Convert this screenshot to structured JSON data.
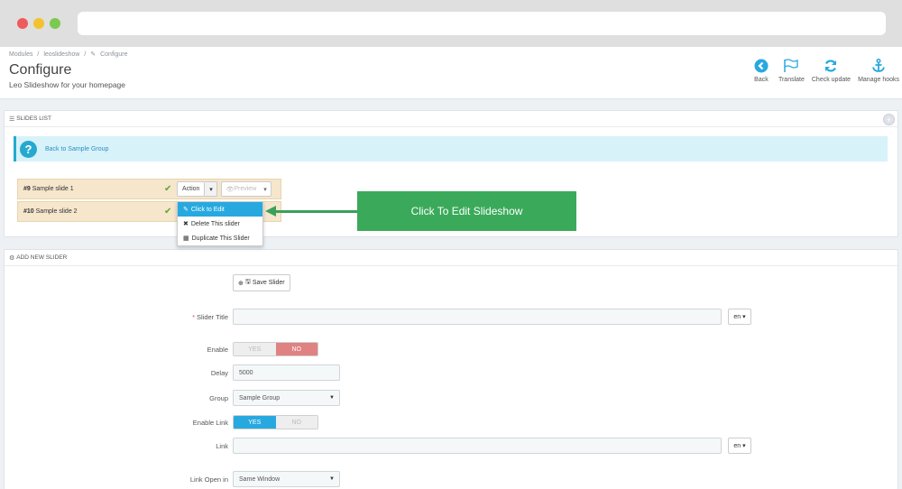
{
  "breadcrumb": [
    "Modules",
    "/",
    "leoslideshow",
    "/",
    "Configure"
  ],
  "header": {
    "title": "Configure",
    "subtitle": "Leo Slideshow for your homepage"
  },
  "toolbar": {
    "back": "Back",
    "translate": "Translate",
    "check_update": "Check update",
    "manage_hooks": "Manage hooks"
  },
  "colors": {
    "accent": "#27a9e0",
    "callout": "#3aaa5a",
    "slide_row": "#f5e6cc",
    "no_active": "#e08282"
  },
  "slides_panel": {
    "title": "SLIDES LIST",
    "back_link": "Back to Sample Group",
    "slides": [
      {
        "id": "#9",
        "name": "Sample slide 1"
      },
      {
        "id": "#10",
        "name": "Sample slide 2"
      }
    ],
    "action_label": "Action",
    "preview_label": "Preview",
    "dropdown": [
      "Click to Edit",
      "Delete This slider",
      "Duplicate This Slider"
    ],
    "callout": "Click To Edit Slideshow"
  },
  "add_panel": {
    "title": "ADD NEW SLIDER",
    "save_label": "Save Slider",
    "fields": {
      "slider_title": {
        "label": "Slider Title",
        "value": "",
        "lang": "en"
      },
      "enable": {
        "label": "Enable",
        "yes": "YES",
        "no": "NO",
        "value": "NO"
      },
      "delay": {
        "label": "Delay",
        "value": "5000"
      },
      "group": {
        "label": "Group",
        "value": "Sample Group"
      },
      "enable_link": {
        "label": "Enable Link",
        "yes": "YES",
        "no": "NO",
        "value": "YES"
      },
      "link": {
        "label": "Link",
        "value": "",
        "lang": "en"
      },
      "link_open": {
        "label": "Link Open in",
        "value": "Same Window"
      }
    }
  }
}
